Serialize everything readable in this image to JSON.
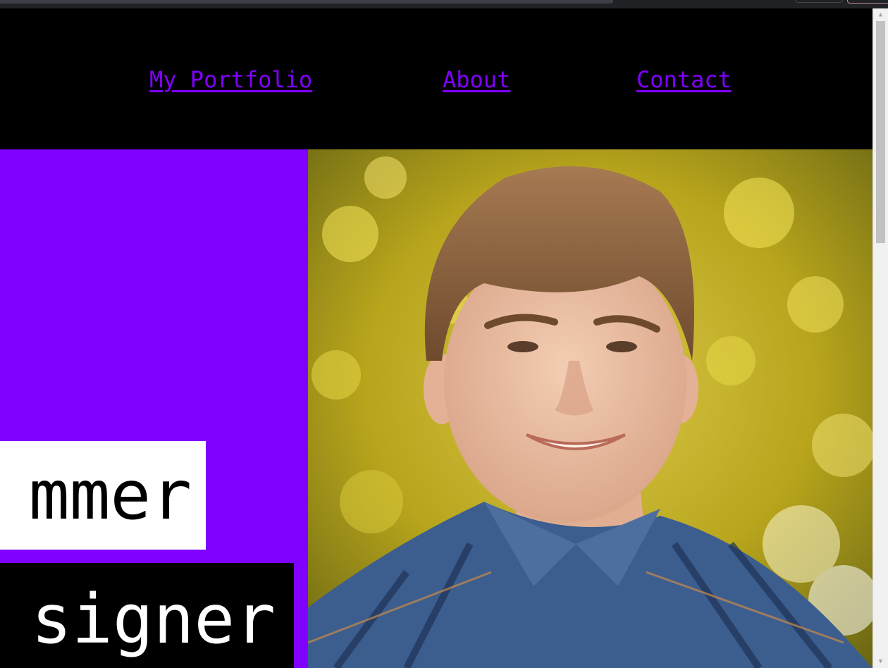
{
  "nav": {
    "items": [
      {
        "label": "My Portfolio"
      },
      {
        "label": "About"
      },
      {
        "label": "Contact"
      }
    ]
  },
  "hero": {
    "tag_white": "mmer",
    "tag_black": "signer"
  },
  "scrollbar": {
    "up_icon": "▲",
    "down_icon": "▼"
  },
  "colors": {
    "accent": "#8000ff",
    "background": "#000000",
    "white_tag": "#ffffff"
  }
}
